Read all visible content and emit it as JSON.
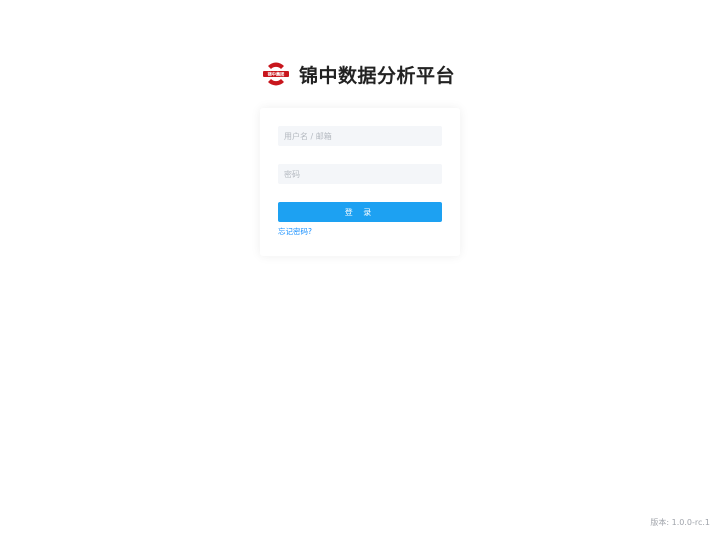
{
  "brand": {
    "logo_icon": "jinzhong-group-logo-icon",
    "logo_text": "锦中集团",
    "title": "锦中数据分析平台"
  },
  "login": {
    "username_placeholder": "用户名 / 邮箱",
    "password_placeholder": "密码",
    "login_label": "登 录",
    "forgot_label": "忘记密码?"
  },
  "footer": {
    "version": "版本: 1.0.0-rc.1"
  },
  "colors": {
    "primary": "#1da1f2",
    "logo_red": "#c8161d",
    "link": "#1890ff"
  }
}
